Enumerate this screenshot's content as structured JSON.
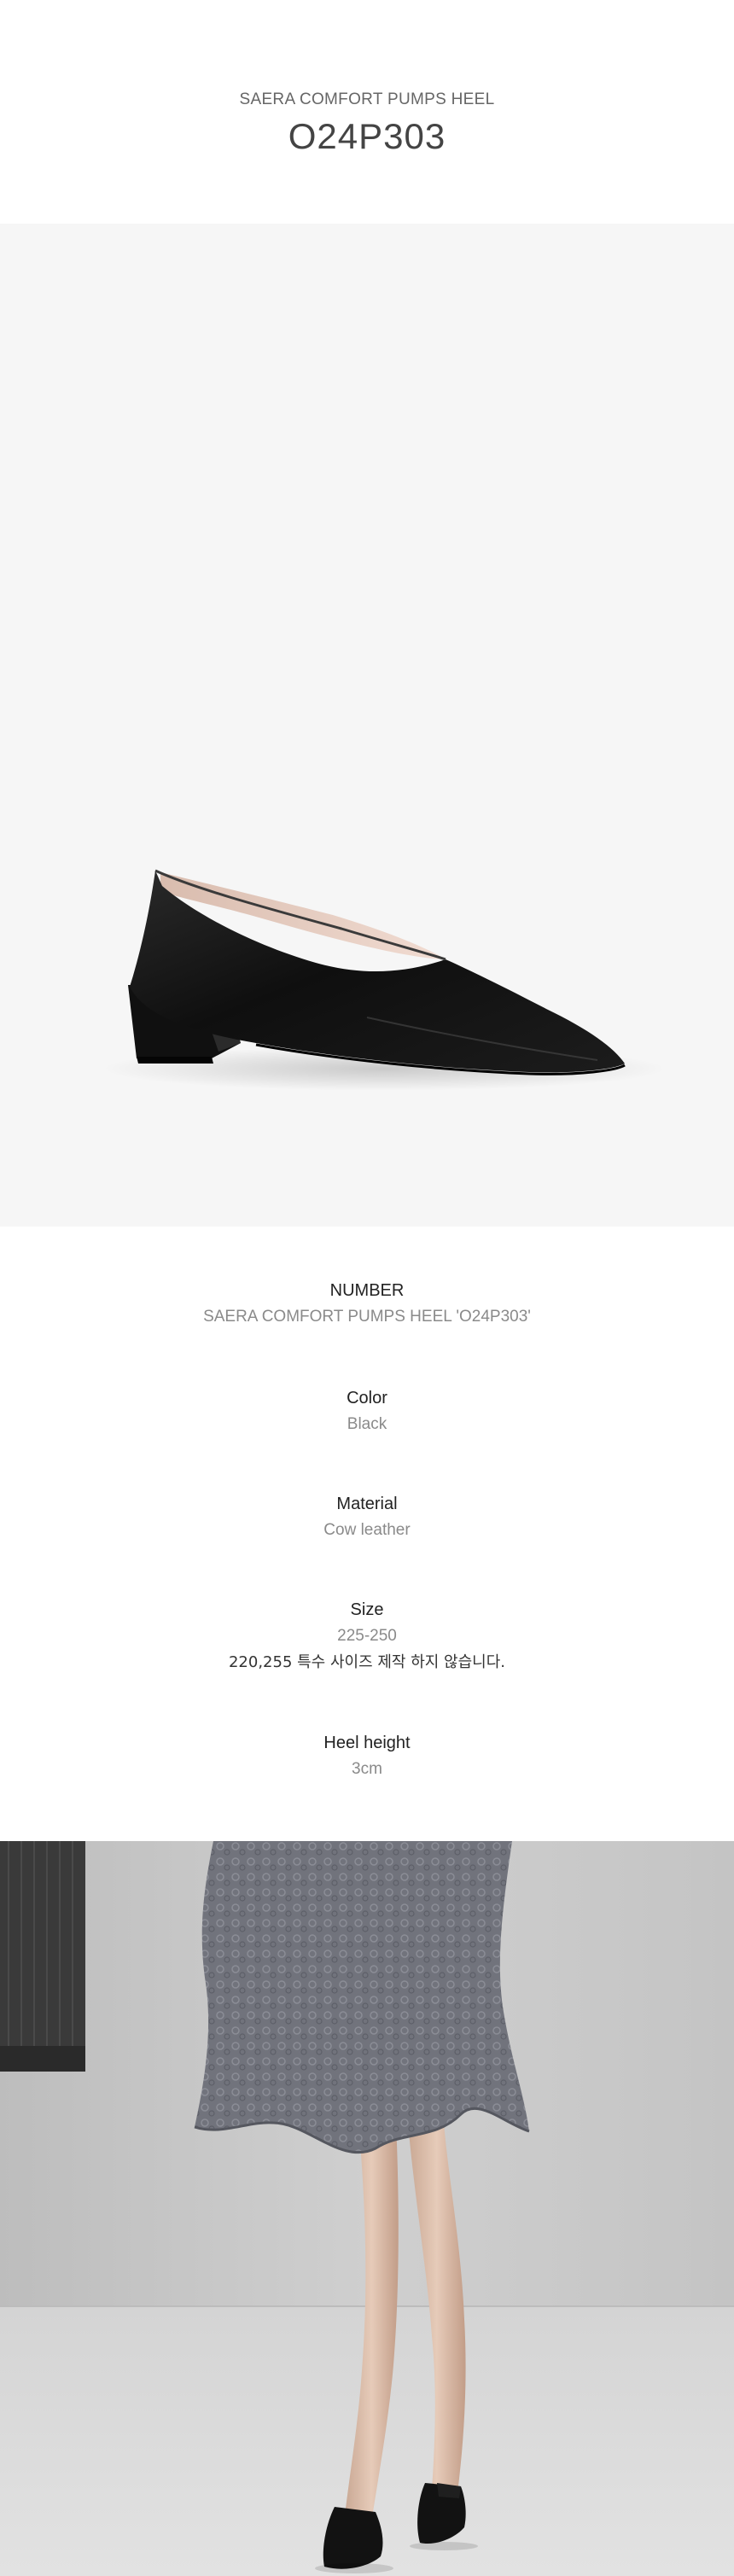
{
  "header": {
    "subtitle": "SAERA COMFORT PUMPS HEEL",
    "model": "O24P303"
  },
  "details": {
    "number": {
      "label": "NUMBER",
      "value": "SAERA COMFORT PUMPS HEEL 'O24P303'"
    },
    "color": {
      "label": "Color",
      "value": "Black"
    },
    "material": {
      "label": "Material",
      "value": "Cow leather"
    },
    "size": {
      "label": "Size",
      "value": "225-250",
      "note": "220,255 특수 사이즈 제작 하지 않습니다."
    },
    "heel_height": {
      "label": "Heel height",
      "value": "3cm"
    }
  },
  "colors": {
    "shoe": "#141414",
    "lining": "#e8cfc4",
    "photo_bg": "#f6f6f6",
    "dress": "#6f7078",
    "wall": "#c8c8c8"
  }
}
